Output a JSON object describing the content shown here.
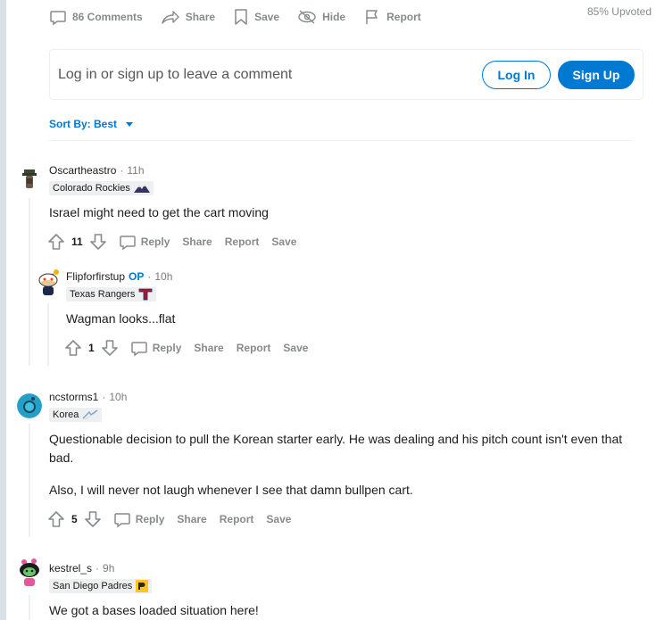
{
  "post_actions": {
    "comments": "86 Comments",
    "share": "Share",
    "save": "Save",
    "hide": "Hide",
    "report": "Report",
    "upvoted": "85% Upvoted"
  },
  "login_prompt": {
    "text": "Log in or sign up to leave a comment",
    "login_label": "Log In",
    "signup_label": "Sign Up"
  },
  "sort": {
    "label": "Sort By: Best"
  },
  "comment_actions": {
    "reply": "Reply",
    "share": "Share",
    "report": "Report",
    "save": "Save"
  },
  "comments": [
    {
      "author": "Oscartheastro",
      "time": "11h",
      "flair": "Colorado Rockies",
      "body": [
        "Israel might need to get the cart moving"
      ],
      "score": "11"
    },
    {
      "author": "Flipforfirstup",
      "op": "OP",
      "time": "10h",
      "flair": "Texas Rangers",
      "body": [
        "Wagman looks...flat"
      ],
      "score": "1"
    },
    {
      "author": "ncstorms1",
      "time": "10h",
      "flair": "Korea",
      "body": [
        "Questionable decision to pull the Korean starter early. He was dealing and his pitch count isn't even that bad.",
        "Also, I will never not laugh whenever I see that damn bullpen cart."
      ],
      "score": "5"
    },
    {
      "author": "kestrel_s",
      "time": "9h",
      "flair": "San Diego Padres",
      "body": [
        "We got a bases loaded situation here!"
      ]
    }
  ],
  "colors": {
    "accent": "#0079d3",
    "muted": "#878a8c",
    "text": "#1c1c1c"
  }
}
